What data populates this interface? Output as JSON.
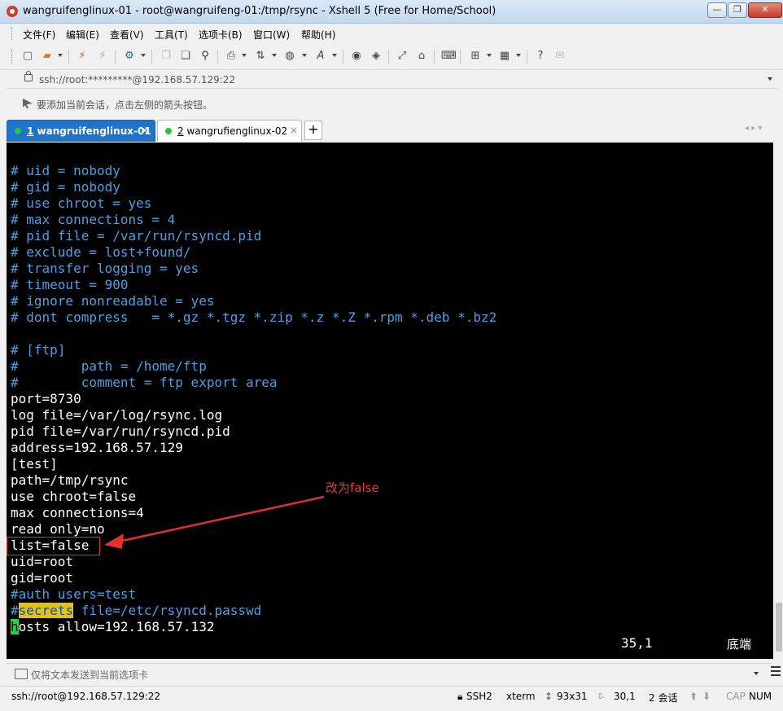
{
  "window": {
    "title": "wangruifenglinux-01 - root@wangruifeng-01:/tmp/rsync - Xshell 5 (Free for Home/School)",
    "controls": {
      "minimize": "—",
      "maximize": "❐",
      "close": "✕"
    }
  },
  "menu": {
    "items": [
      "文件(F)",
      "编辑(E)",
      "查看(V)",
      "工具(T)",
      "选项卡(B)",
      "窗口(W)",
      "帮助(H)"
    ]
  },
  "toolbar": {
    "icons": [
      "new-session-icon",
      "open-folder-icon",
      "connect-icon",
      "disconnect-icon",
      "properties-icon",
      "copy-icon",
      "paste-icon",
      "find-icon",
      "print-icon",
      "transfer-icon",
      "globe-icon",
      "font-icon",
      "xftp-icon",
      "xagent-icon",
      "fullscreen-icon",
      "lock-icon",
      "keyboard-icon",
      "add-tab-icon",
      "layout-icon",
      "help-icon",
      "chat-icon"
    ]
  },
  "address": {
    "text": "ssh://root:*********@192.168.57.129:22"
  },
  "hint": {
    "text": "要添加当前会话，点击左侧的箭头按钮。"
  },
  "tabs": [
    {
      "index": "1",
      "label": "wangruifenglinux-01",
      "active": true,
      "close": "×"
    },
    {
      "index": "2",
      "label": "wangrufienglinux-02",
      "active": false,
      "close": "×"
    }
  ],
  "tab_add": "+",
  "tab_nav": "◂ ▸ ▾",
  "terminal": {
    "lines": [
      {
        "text": "# uid = nobody",
        "style": "comment"
      },
      {
        "text": "# gid = nobody",
        "style": "comment"
      },
      {
        "text": "# use chroot = yes",
        "style": "comment"
      },
      {
        "text": "# max connections = 4",
        "style": "comment"
      },
      {
        "text": "# pid file = /var/run/rsyncd.pid",
        "style": "comment"
      },
      {
        "text": "# exclude = lost+found/",
        "style": "comment"
      },
      {
        "text": "# transfer logging = yes",
        "style": "comment"
      },
      {
        "text": "# timeout = 900",
        "style": "comment"
      },
      {
        "text": "# ignore nonreadable = yes",
        "style": "comment"
      },
      {
        "text": "# dont compress   = *.gz *.tgz *.zip *.z *.Z *.rpm *.deb *.bz2",
        "style": "comment"
      },
      {
        "text": "",
        "style": "plain"
      },
      {
        "text": "# [ftp]",
        "style": "comment"
      },
      {
        "text": "#        path = /home/ftp",
        "style": "comment"
      },
      {
        "text": "#        comment = ftp export area",
        "style": "comment"
      },
      {
        "text": "port=8730",
        "style": "plain"
      },
      {
        "text": "log file=/var/log/rsync.log",
        "style": "plain"
      },
      {
        "text": "pid file=/var/run/rsyncd.pid",
        "style": "plain"
      },
      {
        "text": "address=192.168.57.129",
        "style": "plain"
      },
      {
        "text": "[test]",
        "style": "plain"
      },
      {
        "text": "path=/tmp/rsync",
        "style": "plain"
      },
      {
        "text": "use chroot=false",
        "style": "plain"
      },
      {
        "text": "max connections=4",
        "style": "plain"
      },
      {
        "text": "read only=no",
        "style": "plain"
      },
      {
        "text": "list=false",
        "style": "plain"
      },
      {
        "text": "uid=root",
        "style": "plain"
      },
      {
        "text": "gid=root",
        "style": "plain"
      },
      {
        "text": "#auth users=test",
        "style": "comment"
      },
      {
        "prefix": "#",
        "highlight": "secrets",
        "text": " file=/etc/rsyncd.passwd",
        "style": "comment"
      },
      {
        "cursor": "h",
        "text": "osts allow=192.168.57.132",
        "style": "plain"
      }
    ],
    "status_position": "35,1",
    "status_end": "底端",
    "colors": {
      "background": "#000000",
      "comment": "#4f9ee3",
      "text": "#ffffff",
      "highlight": "#e0c21a",
      "cursor": "#24d24a"
    }
  },
  "annotation": {
    "text": "改为false",
    "color": "#e03030"
  },
  "sendbar": {
    "placeholder": "仅将文本发送到当前选项卡"
  },
  "statusbar": {
    "connection": "ssh://root@192.168.57.129:22",
    "protocol": "SSH2",
    "terminal": "xterm",
    "size": "93x31",
    "cursor_pos": "30,1",
    "sessions": "2 会话",
    "caps": "CAP",
    "num": "NUM"
  }
}
